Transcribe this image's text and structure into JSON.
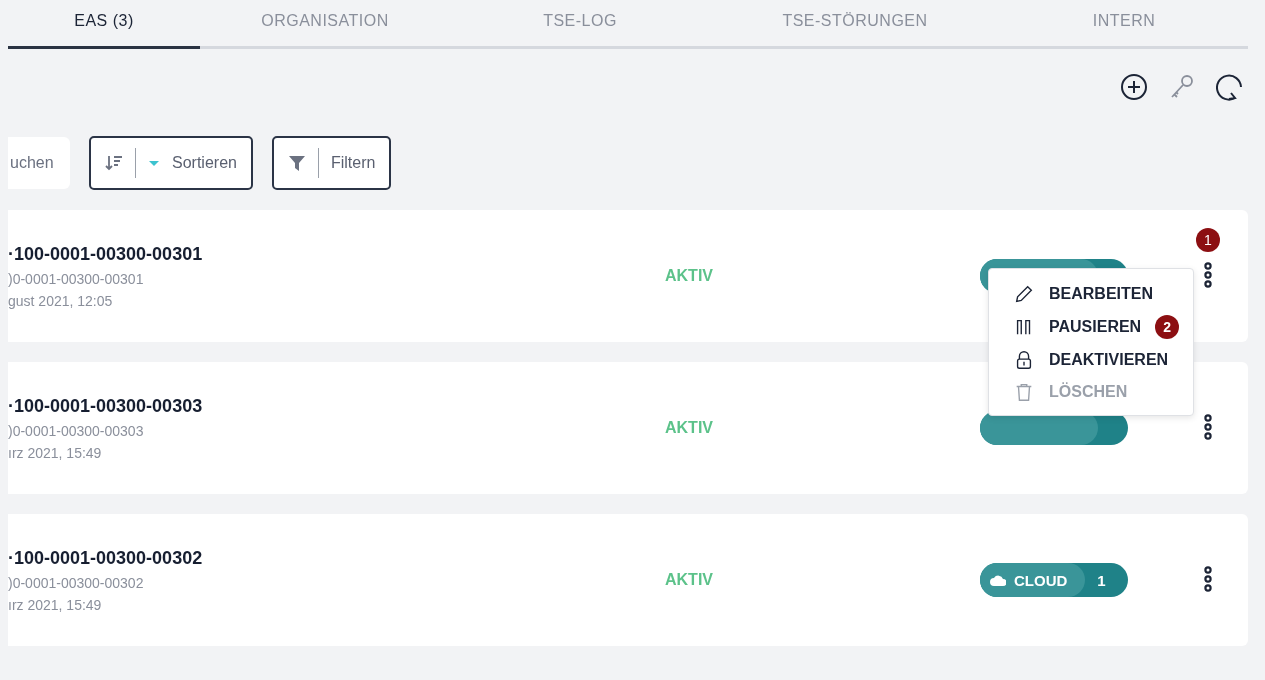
{
  "tabs": [
    {
      "label": "EAS (3)",
      "selected": true
    },
    {
      "label": "ORGANISATION",
      "selected": false
    },
    {
      "label": "TSE-LOG",
      "selected": false
    },
    {
      "label": "TSE-STÖRUNGEN",
      "selected": false
    },
    {
      "label": "INTERN",
      "selected": false
    }
  ],
  "search": {
    "placeholder": "uchen"
  },
  "sort_button": {
    "label": "Sortieren"
  },
  "filter_button": {
    "label": "Filtern"
  },
  "rows": [
    {
      "title": "·100-0001-00300-00301",
      "subtitle": ")0-0001-00300-00301",
      "date": "gust 2021, 12:05",
      "status": "AKTIV",
      "has_tag": true,
      "marker": "1"
    },
    {
      "title": "·100-0001-00300-00303",
      "subtitle": ")0-0001-00300-00303",
      "date": "ırz 2021, 15:49",
      "status": "AKTIV",
      "has_tag": true
    },
    {
      "title": "·100-0001-00300-00302",
      "subtitle": ")0-0001-00300-00302",
      "date": "ırz 2021, 15:49",
      "status": "AKTIV",
      "has_tag": true,
      "tag": {
        "label": "CLOUD",
        "count": "1"
      }
    }
  ],
  "menu": {
    "items": [
      {
        "kind": "edit",
        "label": "BEARBEITEN",
        "disabled": false
      },
      {
        "kind": "pause",
        "label": "PAUSIEREN",
        "disabled": false,
        "marker": "2"
      },
      {
        "kind": "lock",
        "label": "DEAKTIVIEREN",
        "disabled": false
      },
      {
        "kind": "delete",
        "label": "LÖSCHEN",
        "disabled": true
      }
    ]
  }
}
